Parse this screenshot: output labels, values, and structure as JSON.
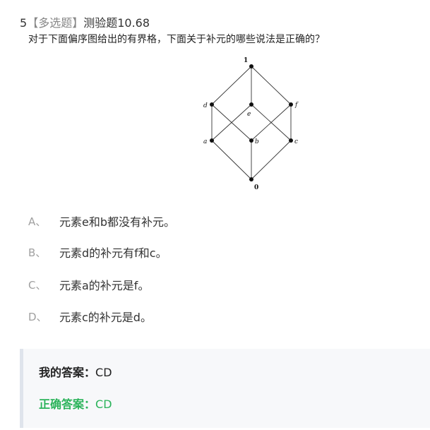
{
  "question": {
    "number": "5",
    "type": "【多选题】",
    "title": "测验题10.68",
    "text": "对于下面偏序图给出的有界格，下面关于补元的哪些说法是正确的？"
  },
  "diagram": {
    "nodes": {
      "top": "1",
      "d": "d",
      "e": "e",
      "f": "f",
      "a": "a",
      "b": "b",
      "c": "c",
      "bottom": "0"
    }
  },
  "options": [
    {
      "letter": "A、",
      "text": "元素e和b都没有补元。"
    },
    {
      "letter": "B、",
      "text": "元素d的补元有f和c。"
    },
    {
      "letter": "C、",
      "text": "元素a的补元是f。"
    },
    {
      "letter": "D、",
      "text": "元素c的补元是d。"
    }
  ],
  "answers": {
    "my_label": "我的答案：",
    "my_value": "CD",
    "correct_label": "正确答案：",
    "correct_value": "CD"
  },
  "colors": {
    "correct": "#2bb35a",
    "option_letter": "#a0a0a0",
    "answer_bg": "#f7f8fa"
  }
}
